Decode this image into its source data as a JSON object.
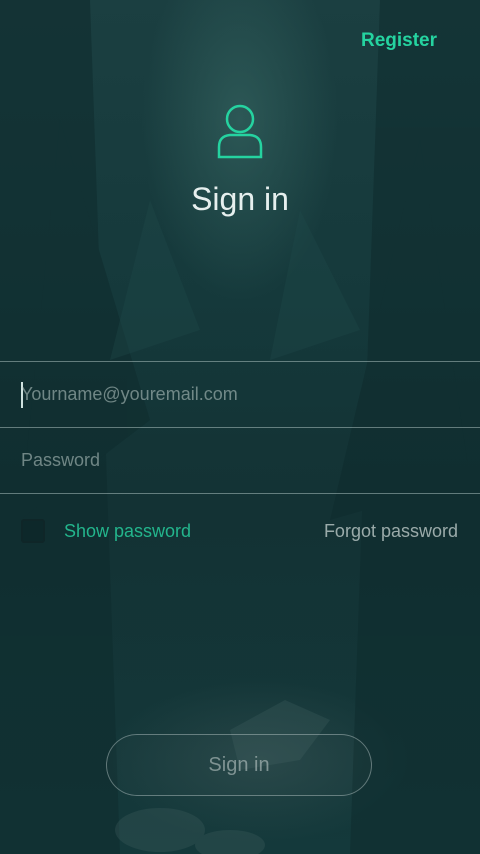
{
  "header": {
    "register_label": "Register"
  },
  "title": "Sign in",
  "form": {
    "email_placeholder": "Yourname@youremail.com",
    "password_placeholder": "Password",
    "show_password_label": "Show password",
    "show_password_checked": false,
    "forgot_password_label": "Forgot password"
  },
  "submit_label": "Sign in",
  "colors": {
    "accent": "#25d3a0",
    "background": "#16363a",
    "text": "#e6efee"
  },
  "icons": {
    "user": "user-outline-icon"
  }
}
